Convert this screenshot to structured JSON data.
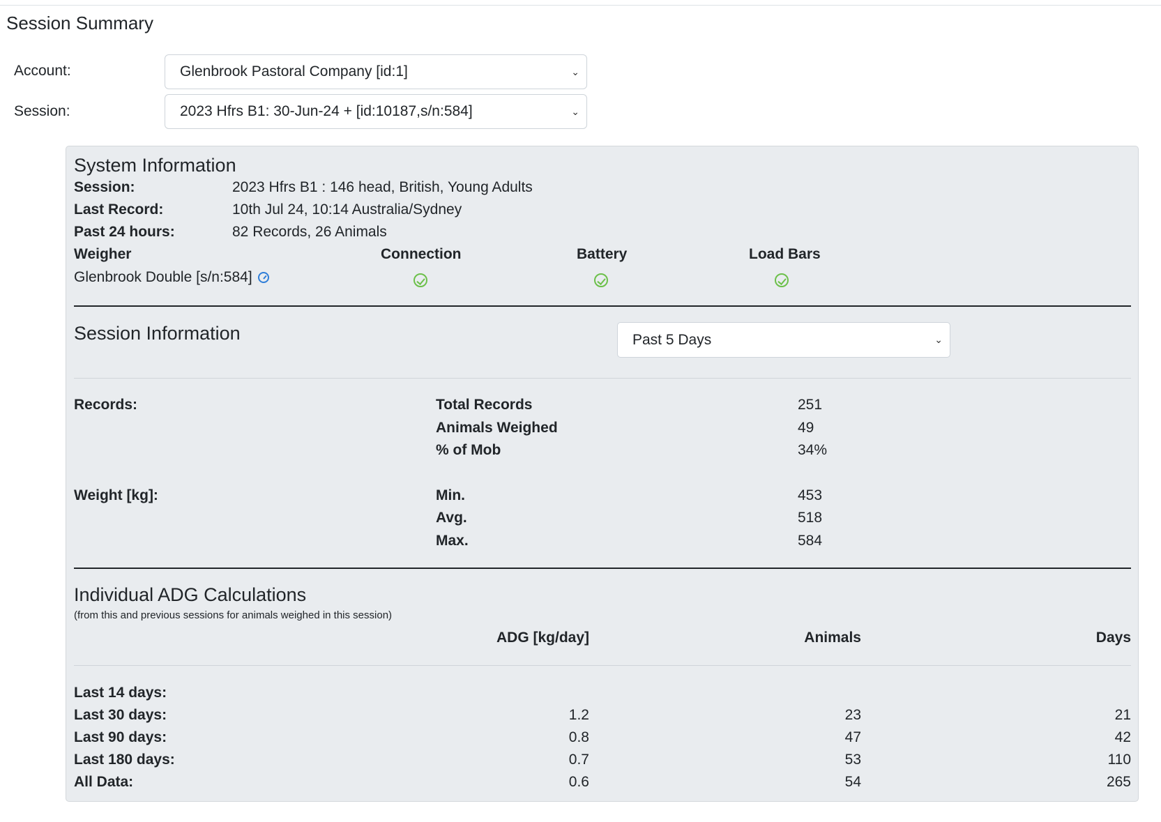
{
  "page": {
    "title": "Session Summary"
  },
  "form": {
    "account_label": "Account:",
    "account_value": "Glenbrook Pastoral Company [id:1]",
    "session_label": "Session:",
    "session_value": "2023 Hfrs B1: 30-Jun-24 + [id:10187,s/n:584]"
  },
  "system": {
    "title": "System Information",
    "session_label": "Session:",
    "session_value": "2023 Hfrs B1 : 146 head, British, Young Adults",
    "last_record_label": "Last Record:",
    "last_record_value": "10th Jul 24, 10:14 Australia/Sydney",
    "past24_label": "Past 24 hours:",
    "past24_value": "82 Records, 26 Animals",
    "headers": {
      "weigher": "Weigher",
      "connection": "Connection",
      "battery": "Battery",
      "load_bars": "Load Bars"
    },
    "weigher_value": "Glenbrook Double [s/n:584]",
    "status_icons": {
      "connection": "check-circle-icon",
      "battery": "check-circle-icon",
      "load_bars": "check-circle-icon",
      "weigher": "gauge-icon"
    },
    "colors": {
      "ok": "#6cc04a",
      "info": "#2f7ed8"
    }
  },
  "session_info": {
    "title": "Session Information",
    "period_value": "Past 5 Days",
    "records_label": "Records:",
    "total_records_label": "Total Records",
    "total_records_value": "251",
    "animals_weighed_label": "Animals Weighed",
    "animals_weighed_value": "49",
    "pct_mob_label": "% of Mob",
    "pct_mob_value": "34%",
    "weight_label": "Weight [kg]:",
    "min_label": "Min.",
    "min_value": "453",
    "avg_label": "Avg.",
    "avg_value": "518",
    "max_label": "Max.",
    "max_value": "584"
  },
  "adg": {
    "title": "Individual ADG Calculations",
    "subtitle": "(from this and previous sessions for animals weighed in this session)",
    "columns": {
      "adg": "ADG [kg/day]",
      "animals": "Animals",
      "days": "Days"
    },
    "rows": [
      {
        "label": "Last 14 days:",
        "adg": "",
        "animals": "",
        "days": ""
      },
      {
        "label": "Last 30 days:",
        "adg": "1.2",
        "animals": "23",
        "days": "21"
      },
      {
        "label": "Last 90 days:",
        "adg": "0.8",
        "animals": "47",
        "days": "42"
      },
      {
        "label": "Last 180 days:",
        "adg": "0.7",
        "animals": "53",
        "days": "110"
      },
      {
        "label": "All Data:",
        "adg": "0.6",
        "animals": "54",
        "days": "265"
      }
    ]
  }
}
